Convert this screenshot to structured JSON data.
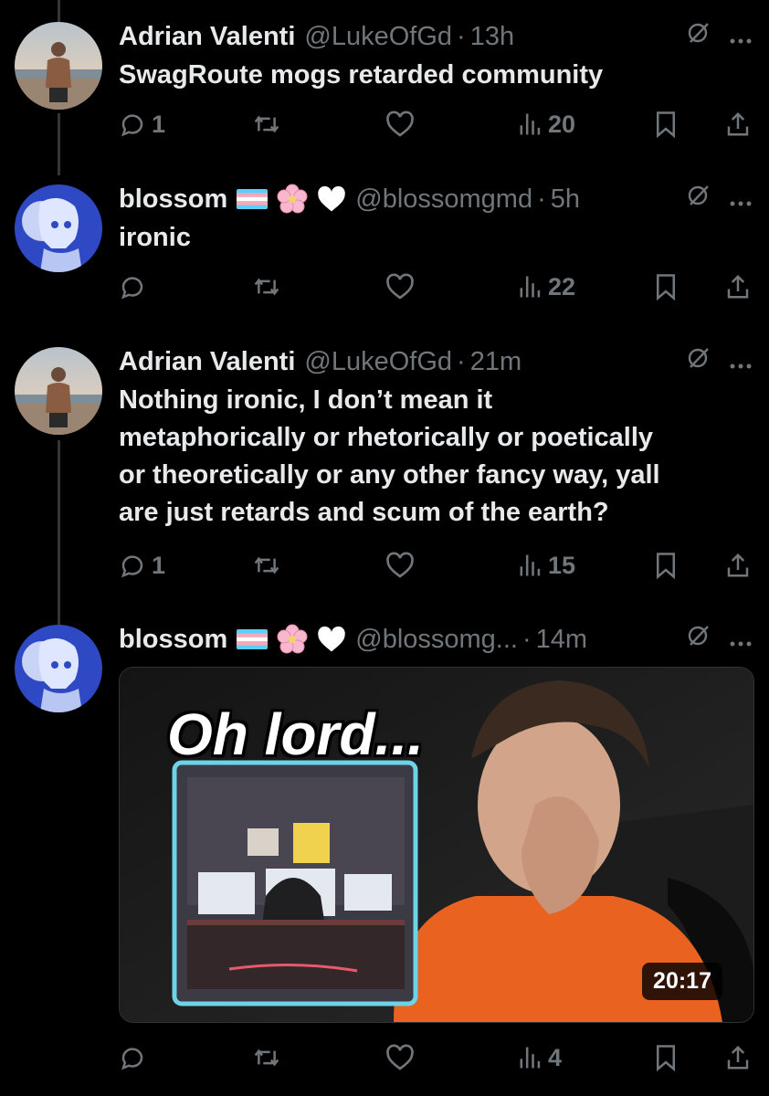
{
  "tweets": [
    {
      "name": "Adrian Valenti",
      "handle": "@LukeOfGd",
      "sep": "·",
      "time": "13h",
      "text": "SwagRoute mogs retarded community",
      "replies": "1",
      "views": "20",
      "avatar": "avatar-beach-man"
    },
    {
      "name": "blossom",
      "handle": "@blossomgmd",
      "sep": "·",
      "time": "5h",
      "text": "ironic",
      "replies": "",
      "views": "22",
      "avatar": "avatar-anime-girl",
      "name_emojis": [
        "trans-flag-icon",
        "cherry-blossom-icon",
        "white-heart-icon"
      ]
    },
    {
      "name": "Adrian Valenti",
      "handle": "@LukeOfGd",
      "sep": "·",
      "time": "21m",
      "text_lines": [
        "Nothing ironic, I don’t mean it",
        "metaphorically or rhetorically or poetically",
        "or theoretically or any other fancy way, yall",
        "are just retards and scum of the earth?"
      ],
      "replies": "1",
      "views": "15",
      "avatar": "avatar-beach-man"
    },
    {
      "name": "blossom",
      "handle": "@blossomg...",
      "sep": "·",
      "time": "14m",
      "replies": "",
      "views": "4",
      "avatar": "avatar-anime-girl",
      "name_emojis": [
        "trans-flag-icon",
        "cherry-blossom-icon",
        "white-heart-icon"
      ],
      "media": {
        "overlay_text": "Oh lord...",
        "duration": "20:17"
      }
    }
  ],
  "icons": {
    "grok": "grok-icon",
    "more": "more-icon",
    "reply": "reply-icon",
    "retweet": "retweet-icon",
    "like": "like-icon",
    "views": "views-icon",
    "bookmark": "bookmark-icon",
    "share": "share-icon"
  },
  "colors": {
    "background": "#000000",
    "text": "#e7e9ea",
    "muted": "#71767b",
    "thread_line": "#333639"
  }
}
